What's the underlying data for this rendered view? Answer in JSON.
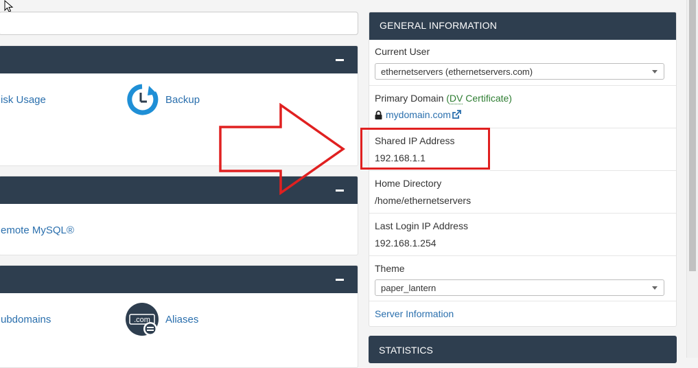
{
  "left": {
    "panel1": {
      "items": [
        {
          "label": "isk Usage",
          "icon": "disk-usage-icon"
        },
        {
          "label": "Backup",
          "icon": "backup-icon"
        }
      ]
    },
    "panel2": {
      "items": [
        {
          "label": "emote MySQL®"
        }
      ]
    },
    "panel3": {
      "items": [
        {
          "label": "ubdomains"
        },
        {
          "label": "Aliases",
          "icon": "aliases-icon",
          "icon_text": ".com"
        }
      ]
    }
  },
  "general_info": {
    "title": "GENERAL INFORMATION",
    "current_user": {
      "label": "Current User",
      "value": "ethernetservers (ethernetservers.com)"
    },
    "primary_domain": {
      "label": "Primary Domain",
      "cert_open": "(",
      "cert": "DV",
      "cert_rest": " Certificate)",
      "domain": "mydomain.com"
    },
    "shared_ip": {
      "label": "Shared IP Address",
      "value": "192.168.1.1"
    },
    "home_dir": {
      "label": "Home Directory",
      "value": "/home/ethernetservers"
    },
    "last_login": {
      "label": "Last Login IP Address",
      "value": "192.168.1.254"
    },
    "theme": {
      "label": "Theme",
      "value": "paper_lantern"
    },
    "server_info_link": "Server Information"
  },
  "statistics": {
    "title": "STATISTICS"
  },
  "colors": {
    "header": "#2e3e4f",
    "link": "#2a6fad",
    "annotation": "#e02020",
    "cert": "#2e7d32"
  }
}
